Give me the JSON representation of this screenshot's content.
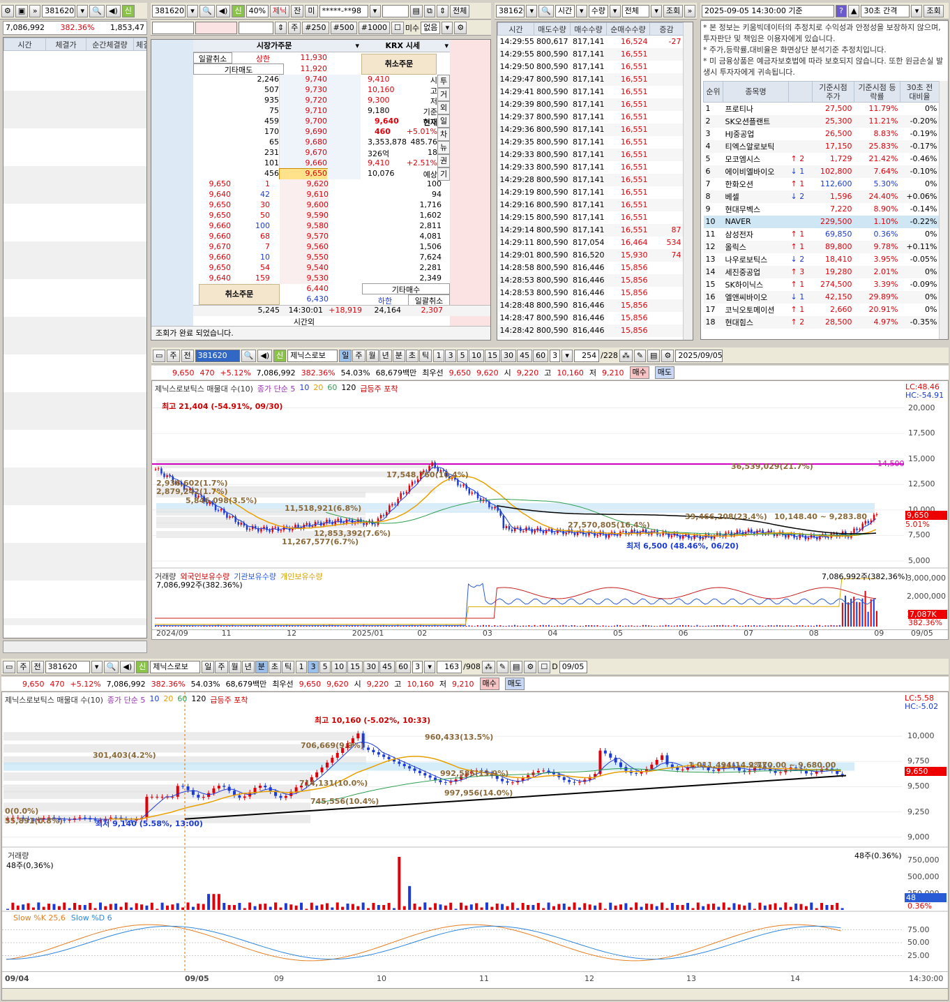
{
  "left": {
    "toolbar": {
      "code": "381620"
    },
    "summary": {
      "volume": "7,086,992",
      "rate": "382.36%",
      "amount": "1,853,47"
    },
    "columns": [
      "시간",
      "체결가",
      "순간체결량",
      "체결"
    ]
  },
  "order": {
    "toolbar": {
      "code": "381620",
      "margin": "40%",
      "name": "제닉",
      "balance": "잔",
      "unit": "미",
      "account": "*****-**98",
      "all_button": "전체",
      "pw": "",
      "stock_btn": "주",
      "q1": "#250",
      "q2": "#500",
      "q3": "#1000",
      "unsettled": "미수",
      "none": "없음"
    },
    "market_order_label": "시장가주문",
    "krx_label": "KRX 시세",
    "daily_cancel": "일괄취소",
    "upper_limit": "상한",
    "upper_price": "11,930",
    "other_sell": "기타매도",
    "other_sell_price": "11,920",
    "cancel_order": "취소주문",
    "cancel_order2": "취소주문",
    "asks": [
      [
        "2,246",
        "9,740"
      ],
      [
        "507",
        "9,730"
      ],
      [
        "935",
        "9,720"
      ],
      [
        "75",
        "9,710"
      ],
      [
        "459",
        "9,700"
      ],
      [
        "170",
        "9,690"
      ],
      [
        "65",
        "9,680"
      ],
      [
        "231",
        "9,670"
      ],
      [
        "101",
        "9,660"
      ],
      [
        "456",
        "9,650"
      ]
    ],
    "bids": [
      [
        "9,620",
        "100"
      ],
      [
        "9,610",
        "94"
      ],
      [
        "9,600",
        "1,716"
      ],
      [
        "9,590",
        "1,602"
      ],
      [
        "9,580",
        "2,811"
      ],
      [
        "9,570",
        "4,081"
      ],
      [
        "9,560",
        "1,506"
      ],
      [
        "9,550",
        "7,624"
      ],
      [
        "9,540",
        "2,281"
      ],
      [
        "9,530",
        "2,349"
      ]
    ],
    "ticks": [
      [
        "9,650",
        "1"
      ],
      [
        "9,640",
        "42"
      ],
      [
        "9,650",
        "30"
      ],
      [
        "9,650",
        "50"
      ],
      [
        "9,660",
        "100"
      ],
      [
        "9,660",
        "68"
      ],
      [
        "9,670",
        "7"
      ],
      [
        "9,660",
        "10"
      ],
      [
        "9,650",
        "54"
      ],
      [
        "9,640",
        "159"
      ]
    ],
    "info": [
      [
        "9,410",
        "시"
      ],
      [
        "10,160",
        "고"
      ],
      [
        "9,300",
        "저"
      ],
      [
        "9,180",
        "기준"
      ],
      [
        "9,640",
        "현재"
      ],
      [
        "460",
        "+5.01%"
      ],
      [
        "3,353,878",
        "485.76"
      ],
      [
        "326억",
        "18"
      ],
      [
        "9,410",
        "+2.51%"
      ],
      [
        "10,076",
        "예상"
      ]
    ],
    "side_tabs": [
      "투",
      "거",
      "외",
      "일",
      "차",
      "뉴",
      "권",
      "기"
    ],
    "bottom": {
      "p1": "6,440",
      "p2": "6,430",
      "other_buy": "기타매수",
      "lower": "하한",
      "daily_cancel": "일괄취소",
      "total_ask": "5,245",
      "time": "14:30:01",
      "diff": "+18,919",
      "total_bid": "24,164",
      "v": "2,307",
      "after": "시간외"
    },
    "status": "조회가 완료 되었습니다."
  },
  "trades": {
    "toolbar": {
      "code": "381620",
      "f1": "시간",
      "f2": "수량",
      "f3": "전체",
      "query": "조회"
    },
    "columns": [
      "시간",
      "매도수량",
      "매수수량",
      "순매수수량",
      "증감"
    ],
    "rows": [
      [
        "14:29:55",
        "800,617",
        "817,141",
        "16,524",
        "-27"
      ],
      [
        "14:29:55",
        "800,590",
        "817,141",
        "16,551",
        ""
      ],
      [
        "14:29:50",
        "800,590",
        "817,141",
        "16,551",
        ""
      ],
      [
        "14:29:47",
        "800,590",
        "817,141",
        "16,551",
        ""
      ],
      [
        "14:29:41",
        "800,590",
        "817,141",
        "16,551",
        ""
      ],
      [
        "14:29:39",
        "800,590",
        "817,141",
        "16,551",
        ""
      ],
      [
        "14:29:37",
        "800,590",
        "817,141",
        "16,551",
        ""
      ],
      [
        "14:29:36",
        "800,590",
        "817,141",
        "16,551",
        ""
      ],
      [
        "14:29:35",
        "800,590",
        "817,141",
        "16,551",
        ""
      ],
      [
        "14:29:33",
        "800,590",
        "817,141",
        "16,551",
        ""
      ],
      [
        "14:29:33",
        "800,590",
        "817,141",
        "16,551",
        ""
      ],
      [
        "14:29:28",
        "800,590",
        "817,141",
        "16,551",
        ""
      ],
      [
        "14:29:19",
        "800,590",
        "817,141",
        "16,551",
        ""
      ],
      [
        "14:29:16",
        "800,590",
        "817,141",
        "16,551",
        ""
      ],
      [
        "14:29:15",
        "800,590",
        "817,141",
        "16,551",
        ""
      ],
      [
        "14:29:14",
        "800,590",
        "817,141",
        "16,551",
        "87"
      ],
      [
        "14:29:11",
        "800,590",
        "817,054",
        "16,464",
        "534"
      ],
      [
        "14:29:01",
        "800,590",
        "816,520",
        "15,930",
        "74"
      ],
      [
        "14:28:58",
        "800,590",
        "816,446",
        "15,856",
        ""
      ],
      [
        "14:28:53",
        "800,590",
        "816,446",
        "15,856",
        ""
      ],
      [
        "14:28:53",
        "800,590",
        "816,446",
        "15,856",
        ""
      ],
      [
        "14:28:48",
        "800,590",
        "816,446",
        "15,856",
        ""
      ],
      [
        "14:28:47",
        "800,590",
        "816,446",
        "15,856",
        ""
      ],
      [
        "14:28:42",
        "800,590",
        "816,446",
        "15,856",
        ""
      ]
    ]
  },
  "rank": {
    "toolbar": {
      "datetime": "2025-09-05 14:30:00 기준",
      "interval": "30초 간격",
      "query": "조회"
    },
    "notice": [
      "* 본 정보는 키움빅데이터의 추정치로 수익성과 안정성을 보장하지 않으며, 투자판단 및 책임은 이용자에게 있습니다.",
      "* 주가,등락률,대비율은 화면상단 분석기준 추정치입니다.",
      "* 미 금융상품은 예금자보호법에 따라 보호되지 않습니다. 또한 원금손실 발생시 투자자에게 귀속됩니다."
    ],
    "columns": [
      "순위",
      "종목명",
      "",
      "기준시점 주가",
      "기준시점 등락률",
      "30초 전 대비율"
    ],
    "rows": [
      [
        "1",
        "프로티나",
        "",
        "27,500",
        "11.79%",
        "0%"
      ],
      [
        "2",
        "SK오션플랜트",
        "",
        "25,300",
        "11.21%",
        "-0.20%"
      ],
      [
        "3",
        "HJ중공업",
        "",
        "26,500",
        "8.83%",
        "-0.19%"
      ],
      [
        "4",
        "티엑스알로보틱",
        "",
        "17,150",
        "25.83%",
        "-0.17%"
      ],
      [
        "5",
        "모코엠시스",
        "↑ 2",
        "1,729",
        "21.42%",
        "-0.46%"
      ],
      [
        "6",
        "에이비엘바이오",
        "↓ 1",
        "102,800",
        "7.64%",
        "-0.10%"
      ],
      [
        "7",
        "한화오션",
        "↑ 1",
        "112,600",
        "5.30%",
        "0%"
      ],
      [
        "8",
        "베셀",
        "↓ 2",
        "1,596",
        "24.40%",
        "+0.06%"
      ],
      [
        "9",
        "현대무벡스",
        "",
        "7,220",
        "8.90%",
        "-0.14%"
      ],
      [
        "10",
        "NAVER",
        "",
        "229,500",
        "1.10%",
        "-0.22%"
      ],
      [
        "11",
        "삼성전자",
        "↑ 1",
        "69,850",
        "0.36%",
        "0%"
      ],
      [
        "12",
        "올릭스",
        "↑ 1",
        "89,800",
        "9.78%",
        "+0.11%"
      ],
      [
        "13",
        "나우로보틱스",
        "↓ 2",
        "18,410",
        "3.95%",
        "-0.05%"
      ],
      [
        "14",
        "세진중공업",
        "↑ 3",
        "19,280",
        "2.01%",
        "0%"
      ],
      [
        "15",
        "SK하이닉스",
        "↑ 1",
        "274,500",
        "3.39%",
        "-0.09%"
      ],
      [
        "16",
        "엘앤씨바이오",
        "↓ 1",
        "42,150",
        "29.89%",
        "0%"
      ],
      [
        "17",
        "코닉오토메이션",
        "↑ 1",
        "2,660",
        "20.91%",
        "0%"
      ],
      [
        "18",
        "현대힘스",
        "↑ 2",
        "28,500",
        "4.97%",
        "-0.35%"
      ]
    ]
  },
  "chart1": {
    "toolbar": {
      "stock": "주",
      "all": "전",
      "code": "381620",
      "name": "제닉스로보",
      "periods": [
        "일",
        "주",
        "월",
        "년",
        "분",
        "초",
        "틱"
      ],
      "nums": [
        "1",
        "3",
        "5",
        "10",
        "15",
        "30",
        "45",
        "60"
      ],
      "n": "3",
      "count": "254",
      "total": "/228",
      "date": "2025/09/05"
    },
    "info": {
      "price": "9,650",
      "chg": "470",
      "pct": "+5.12%",
      "vol": "7,086,992",
      "volpct": "382.36%",
      "ratio": "54.03%",
      "amt": "68,679백만",
      "best": "최우선",
      "b1": "9,650",
      "b2": "9,620",
      "o_l": "시",
      "o": "9,220",
      "h_l": "고",
      "h": "10,160",
      "l_l": "저",
      "l": "9,210",
      "buy": "매수",
      "sell": "매도"
    },
    "legend": {
      "title": "제닉스로보틱스 매물대 수(10)",
      "ma": "종가 단순 5",
      "m10": "10",
      "m20": "20",
      "m60": "60",
      "m120": "120",
      "surge": "급등주 포착"
    },
    "lc": "LC:48.46",
    "hc": "HC:-54.91",
    "yticks": [
      "20,000",
      "17,500",
      "15,000",
      "12,500",
      "10,000",
      "7,500",
      "5,000"
    ],
    "price_tag": "9,650",
    "pct_tag": "5.01%",
    "line_val": "14,500",
    "ann": {
      "max": "최고 21,404 (-54.91%, 09/30)",
      "min": "최저 6,500 (48.46%, 06/20)",
      "l1": "36,539,029(21.7%)",
      "l2": "17,548,760(10.4%)",
      "l3": "2,936,602(1.7%)",
      "l4": "2,879,242(1.7%)",
      "l5": "5,846,098(3.5%)",
      "l6": "11,518,921(6.8%)",
      "l7": "12,853,392(7.6%)",
      "l8": "11,267,577(6.7%)",
      "l9": "27,570,805(16.4%)",
      "l10": "39,466,208(23.4%)",
      "l11": "10,148.40 ~ 9,283.80"
    },
    "vol_legend": {
      "v": "거래량",
      "f": "외국인보유수량",
      "i": "기관보유수량",
      "p": "개인보유수량",
      "val": "7,086,992주(382.36%)",
      "val2": "7,086,992주(382,36%)"
    },
    "vol_ticks": [
      "3,000,000",
      "2,000,000",
      "1,000,000"
    ],
    "vol_tag": "7,087K",
    "vol_tag2": "382.36%",
    "xticks": [
      "2024/09",
      "11",
      "12",
      "2025/01",
      "02",
      "03",
      "04",
      "05",
      "06",
      "07",
      "08",
      "09"
    ],
    "xend": "09/05"
  },
  "chart2": {
    "toolbar": {
      "stock": "주",
      "all": "전",
      "code": "381620",
      "name": "제닉스로보",
      "periods": [
        "일",
        "주",
        "월",
        "년",
        "분",
        "초",
        "틱"
      ],
      "nums": [
        "1",
        "3",
        "5",
        "10",
        "15",
        "30",
        "45",
        "60"
      ],
      "n": "3",
      "count": "163",
      "total": "/908",
      "d": "D",
      "date": "09/05"
    },
    "info": {
      "price": "9,650",
      "chg": "470",
      "pct": "+5.12%",
      "vol": "7,086,992",
      "volpct": "382.36%",
      "ratio": "54.03%",
      "amt": "68,679백만",
      "best": "최우선",
      "b1": "9,650",
      "b2": "9,620",
      "o_l": "시",
      "o": "9,220",
      "h_l": "고",
      "h": "10,160",
      "l_l": "저",
      "l": "9,210",
      "buy": "매수",
      "sell": "매도"
    },
    "legend": {
      "title": "제닉스로보틱스 매물대 수(10)",
      "ma": "종가 단순 5",
      "m10": "10",
      "m20": "20",
      "m60": "60",
      "m120": "120",
      "surge": "급등주 포착"
    },
    "lc": "LC:5.58",
    "hc": "HC:-5.02",
    "yticks": [
      "10,000",
      "9,750",
      "9,500",
      "9,250",
      "9,000"
    ],
    "price_tag": "9,650",
    "ann": {
      "max": "최고 10,160 (-5.02%, 10:33)",
      "min": "최저 9,140 (5.58%, 13:00)",
      "l1": "960,433(13.5%)",
      "l2": "706,669(9.9%)",
      "l3": "301,403(4.2%)",
      "l4": "714,131(10.0%)",
      "l5": "745,556(10.4%)",
      "l6": "992,585(13.9%)",
      "l7": "997,956(14.0%)",
      "l8": "0(0.0%)",
      "l9": "55,891(0.8%)",
      "l10": "9,770.00 ~ 9,680.00",
      "l11": "1,011,494(14.2%)"
    },
    "vol_legend": {
      "v": "거래량",
      "val": "48주(0.36%)",
      "val_l": "48주(0,36%)"
    },
    "vol_ticks": [
      "750,000",
      "500,000",
      "250,000"
    ],
    "vol_tag": "48",
    "vol_tag2": "0.36%",
    "stoch_legend": {
      "k": "Slow %K 25,6",
      "d": "Slow %D 6"
    },
    "stoch_ticks": [
      "75.00",
      "50.00",
      "25.00"
    ],
    "xticks": [
      "09/04",
      "09/05",
      "09",
      "10",
      "11",
      "12",
      "13",
      "14"
    ],
    "xend": "14:30:00"
  },
  "colors": {
    "up": "#e0000a",
    "down": "#1c3bd6",
    "ma5": "#1c3bd6",
    "ma20": "#e8a000",
    "ma60": "#2e9e4f",
    "ma120": "#000000",
    "line": "#d000c0",
    "band": "#c7e6f7"
  }
}
